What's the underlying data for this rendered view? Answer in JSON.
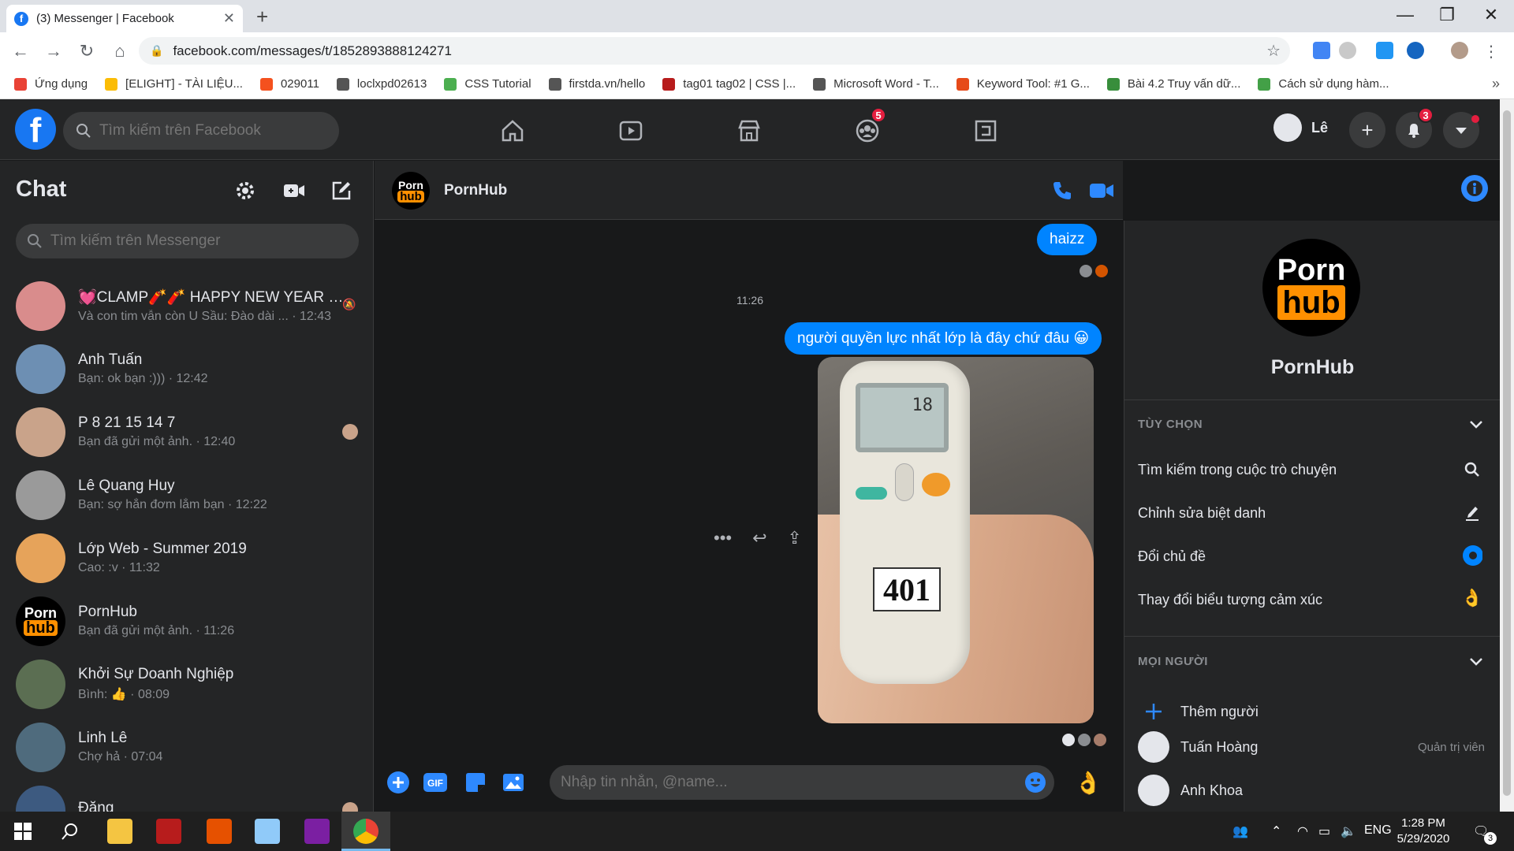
{
  "browser": {
    "tab_title": "(3) Messenger | Facebook",
    "url": "facebook.com/messages/t/1852893888124271",
    "bookmarks": [
      {
        "label": "Ứng dụng",
        "color": "#e94235"
      },
      {
        "label": "[ELIGHT] - TÀI LIỆU...",
        "color": "#fbbc05"
      },
      {
        "label": "029011",
        "color": "#f4511e"
      },
      {
        "label": "loclxpd02613",
        "color": "#555555"
      },
      {
        "label": "CSS Tutorial",
        "color": "#4caf50"
      },
      {
        "label": "firstda.vn/hello",
        "color": "#555555"
      },
      {
        "label": "tag01 tag02 | CSS |...",
        "color": "#b71c1c"
      },
      {
        "label": "Microsoft Word - T...",
        "color": "#555555"
      },
      {
        "label": "Keyword Tool: #1 G...",
        "color": "#e64a19"
      },
      {
        "label": "Bài 4.2 Truy vấn dữ...",
        "color": "#388e3c"
      },
      {
        "label": "Cách sử dụng hàm...",
        "color": "#43a047"
      }
    ],
    "more_bookmarks": "»"
  },
  "facebook": {
    "logo_letter": "f",
    "search_placeholder": "Tìm kiếm trên Facebook",
    "groups_badge": "5",
    "profile_name": "Lê",
    "notifications_badge": "3"
  },
  "chat_list": {
    "title": "Chat",
    "search_placeholder": "Tìm kiếm trên Messenger",
    "conversations": [
      {
        "name": "💓CLAMP🧨🧨 HAPPY NEW YEAR 🏮🎉",
        "preview": "Và con tim vẫn còn U Sầu: Đào dài ... · 12:43",
        "avatar_color": "#d98c8c"
      },
      {
        "name": "Anh Tuấn",
        "preview": "Bạn: ok bạn :))) · 12:42",
        "avatar_color": "#6d8fb3"
      },
      {
        "name": "P 8 21 15 14 7",
        "preview": "Bạn đã gửi một ảnh. · 12:40",
        "avatar_color": "#c9a38a"
      },
      {
        "name": "Lê Quang Huy",
        "preview": "Bạn: sợ hắn đơm lắm bạn · 12:22",
        "avatar_color": "#9a9a9a"
      },
      {
        "name": "Lớp Web - Summer 2019",
        "preview": "Cao: :v · 11:32",
        "avatar_color": "#e6a35a"
      },
      {
        "name": "PornHub",
        "preview": "Bạn đã gửi một ảnh. · 11:26",
        "avatar_color": "#000000"
      },
      {
        "name": "Khởi Sự Doanh Nghiệp",
        "preview": "Bình: 👍 · 08:09",
        "avatar_color": "#5b6e52"
      },
      {
        "name": "Linh Lê",
        "preview": "Chợ hả · 07:04",
        "avatar_color": "#4f6b7d"
      },
      {
        "name": "Đăng",
        "preview": "",
        "avatar_color": "#3d5a80"
      }
    ]
  },
  "conversation": {
    "name": "PornHub",
    "logo_top": "Porn",
    "logo_bottom": "hub",
    "messages": {
      "first": "haizz",
      "timestamp": "11:26",
      "second": "người quyền lực nhất lớp là đây chứ đâu 😀"
    },
    "photo_text": {
      "lcd_value": "18",
      "sticker": "401"
    },
    "composer_placeholder": "Nhập tin nhắn, @name...",
    "reaction_emoji": "👌"
  },
  "info_panel": {
    "name": "PornHub",
    "options_header": "TÙY CHỌN",
    "options": [
      {
        "label": "Tìm kiếm trong cuộc trò chuyện",
        "icon": "search-icon"
      },
      {
        "label": "Chỉnh sửa biệt danh",
        "icon": "pencil-icon"
      },
      {
        "label": "Đổi chủ đề",
        "icon": "theme-icon"
      },
      {
        "label": "Thay đổi biểu tượng cảm xúc",
        "icon": "ok-hand-icon"
      }
    ],
    "people_header": "MỌI NGƯỜI",
    "add_person": "Thêm người",
    "people": [
      {
        "name": "Tuấn Hoàng",
        "role": "Quản trị viên"
      },
      {
        "name": "Anh Khoa",
        "role": ""
      }
    ]
  },
  "taskbar": {
    "language": "ENG",
    "time": "1:28 PM",
    "date": "5/29/2020",
    "notification_count": "3"
  },
  "colors": {
    "messenger_blue": "#0084ff",
    "facebook_blue": "#1877f2",
    "dark_bg": "#18191a",
    "panel_bg": "#242526",
    "pornhub_orange": "#ff9000"
  }
}
